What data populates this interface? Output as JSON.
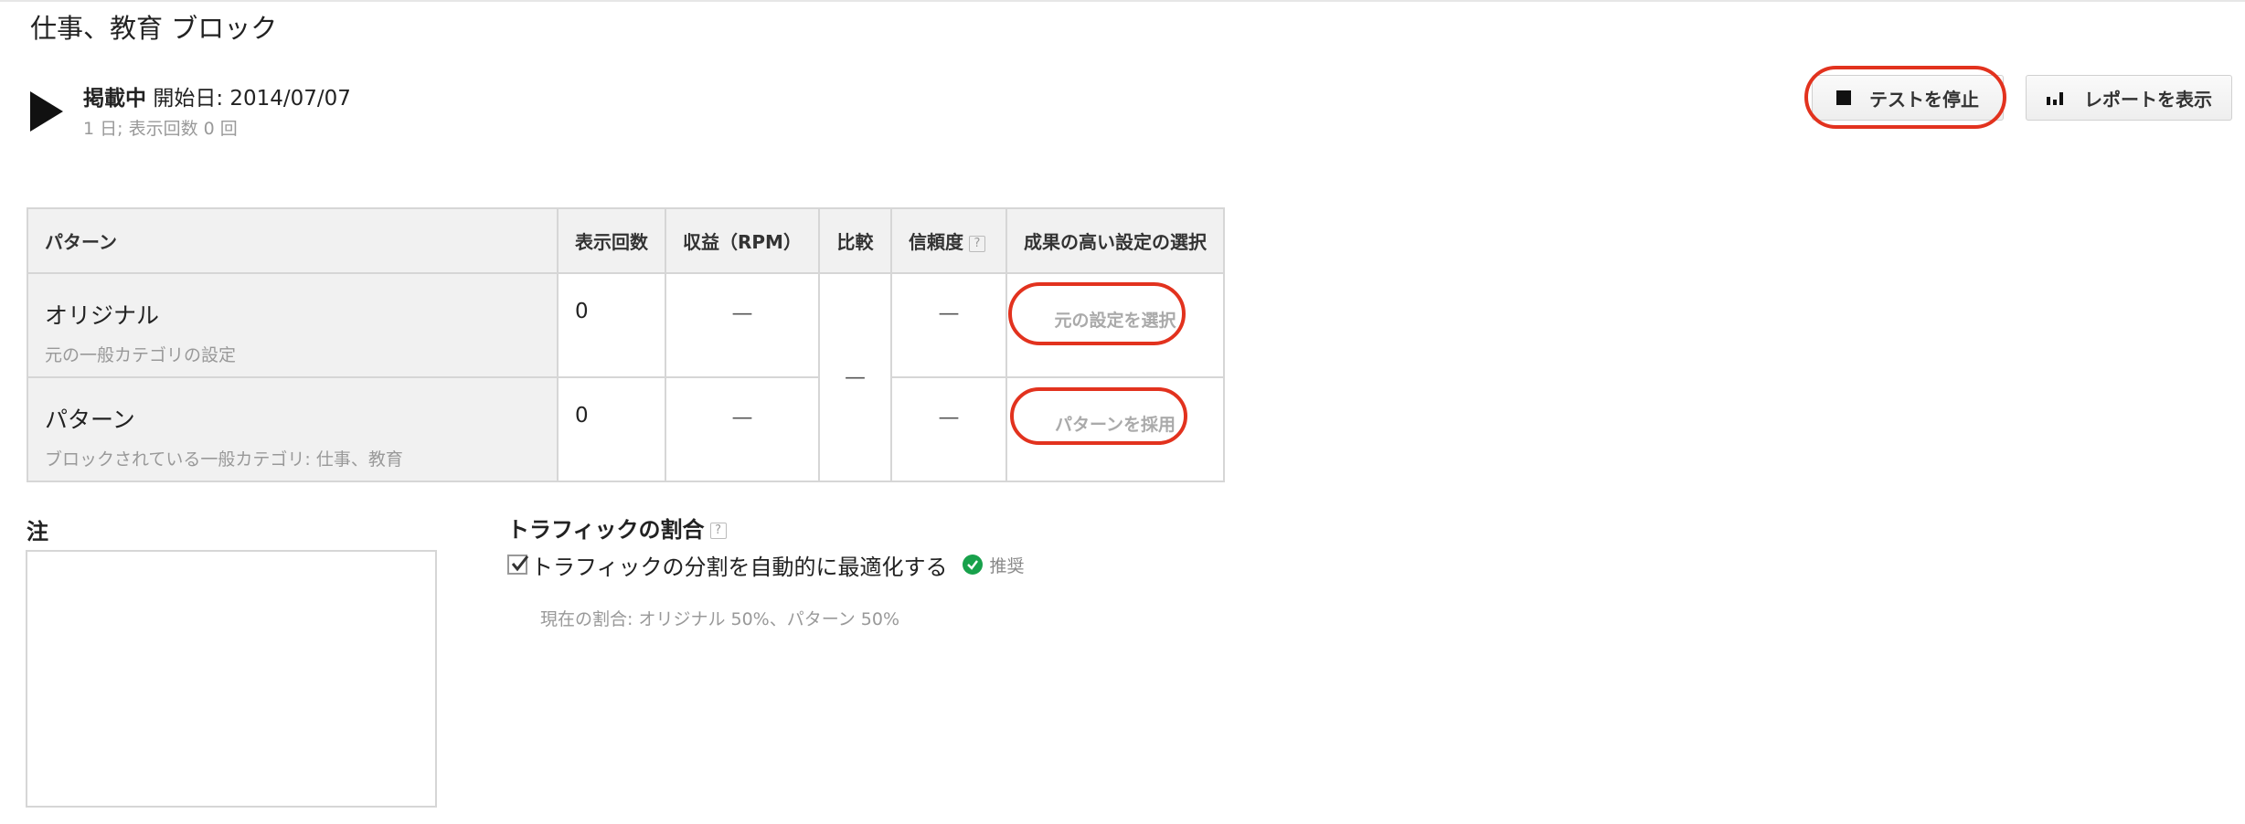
{
  "page": {
    "title": "仕事、教育 ブロック"
  },
  "status": {
    "state": "掲載中",
    "start_label": "開始日: 2014/07/07",
    "summary": "1 日; 表示回数 0 回"
  },
  "actions": {
    "stop_label": "テストを停止",
    "report_label": "レポートを表示",
    "highlight_color": "#e2321e"
  },
  "table": {
    "headers": {
      "pattern": "パターン",
      "impressions": "表示回数",
      "revenue": "収益（RPM）",
      "compare": "比較",
      "confidence": "信頼度",
      "select": "成果の高い設定の選択"
    },
    "compare_value": "—",
    "rows": [
      {
        "name": "オリジナル",
        "desc": "元の一般カテゴリの設定",
        "impressions": "0",
        "revenue": "—",
        "confidence": "—",
        "action": "元の設定を選択"
      },
      {
        "name": "パターン",
        "desc": "ブロックされている一般カテゴリ: 仕事、教育",
        "impressions": "0",
        "revenue": "—",
        "confidence": "—",
        "action": "パターンを採用"
      }
    ]
  },
  "notes": {
    "label": "注",
    "value": ""
  },
  "traffic": {
    "title": "トラフィックの割合",
    "auto_optimize_label": "トラフィックの分割を自動的に最適化する",
    "auto_optimize_checked": true,
    "recommended_label": "推奨",
    "recommended_color": "#18a14b",
    "current_ratio": "現在の割合: オリジナル 50%、パターン 50%"
  },
  "icons": {
    "play": "play-icon",
    "stop": "stop-icon",
    "report": "bar-chart-icon",
    "help": "help-icon",
    "check": "check-circle-icon"
  }
}
